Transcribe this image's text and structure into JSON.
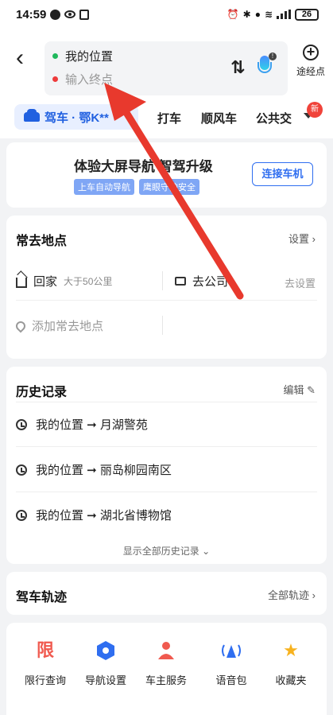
{
  "status": {
    "time": "14:59",
    "battery": "26"
  },
  "search": {
    "start": "我的位置",
    "end_placeholder": "输入终点",
    "waypoint_label": "途经点"
  },
  "tabs": [
    {
      "label": "驾车 · 鄂K**"
    },
    {
      "label": "打车"
    },
    {
      "label": "顺风车"
    },
    {
      "label": "公共交"
    }
  ],
  "tabs_more_badge": "新",
  "promo": {
    "title": "体验大屏导航  智驾升级",
    "tags": [
      "上车自动导航",
      "鹰眼守护安全"
    ],
    "button": "连接车机"
  },
  "frequent": {
    "title": "常去地点",
    "settings": "设置 ›",
    "home_label": "回家",
    "home_sub": "大于50公里",
    "work_label": "去公司",
    "work_action": "去设置",
    "add_label": "添加常去地点"
  },
  "history": {
    "title": "历史记录",
    "edit": "编辑 ✎",
    "items": [
      "我的位置 ➞ 月湖警苑",
      "我的位置 ➞ 丽岛柳园南区",
      "我的位置 ➞ 湖北省博物馆"
    ],
    "show_all": "显示全部历史记录 ⌄"
  },
  "track": {
    "title": "驾车轨迹",
    "link": "全部轨迹 ›"
  },
  "tools": [
    {
      "label": "限行查询",
      "icon": "restriction-icon"
    },
    {
      "label": "导航设置",
      "icon": "hexagon-icon"
    },
    {
      "label": "车主服务",
      "icon": "person-icon"
    },
    {
      "label": "语音包",
      "icon": "voice-icon"
    },
    {
      "label": "收藏夹",
      "icon": "star-icon"
    }
  ],
  "tool_glyphs": {
    "restriction": "限"
  },
  "colors": {
    "accent": "#2f6ef0",
    "arrow": "#e8392d",
    "start_dot": "#1fb85c",
    "end_dot": "#ee3b3b"
  }
}
